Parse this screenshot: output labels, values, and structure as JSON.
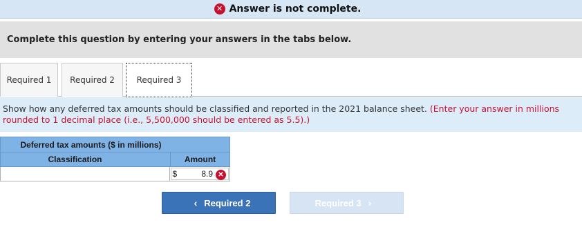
{
  "banner": {
    "icon": "x-circle-icon",
    "text": "Answer is not complete."
  },
  "instruction": "Complete this question by entering your answers in the tabs below.",
  "tabs": [
    {
      "label": "Required 1"
    },
    {
      "label": "Required 2"
    },
    {
      "label": "Required 3"
    }
  ],
  "question": {
    "text": "Show how any deferred tax amounts should be classified and reported in the 2021 balance sheet.",
    "hint": "(Enter your answer in millions rounded to 1 decimal place (i.e., 5,500,000 should be entered as 5.5).)"
  },
  "table": {
    "title": "Deferred tax amounts ($ in millions)",
    "columns": [
      "Classification",
      "Amount"
    ],
    "rows": [
      {
        "classification": "",
        "currency": "$",
        "amount": "8.9",
        "status": "incorrect"
      }
    ]
  },
  "nav": {
    "prev_label": "Required 2",
    "next_label": "Required 3",
    "prev_icon": "chevron-left-icon",
    "next_icon": "chevron-right-icon"
  },
  "colors": {
    "error": "#c8102e",
    "header_blue": "#7fb2e5",
    "button_blue": "#3b73b9"
  }
}
